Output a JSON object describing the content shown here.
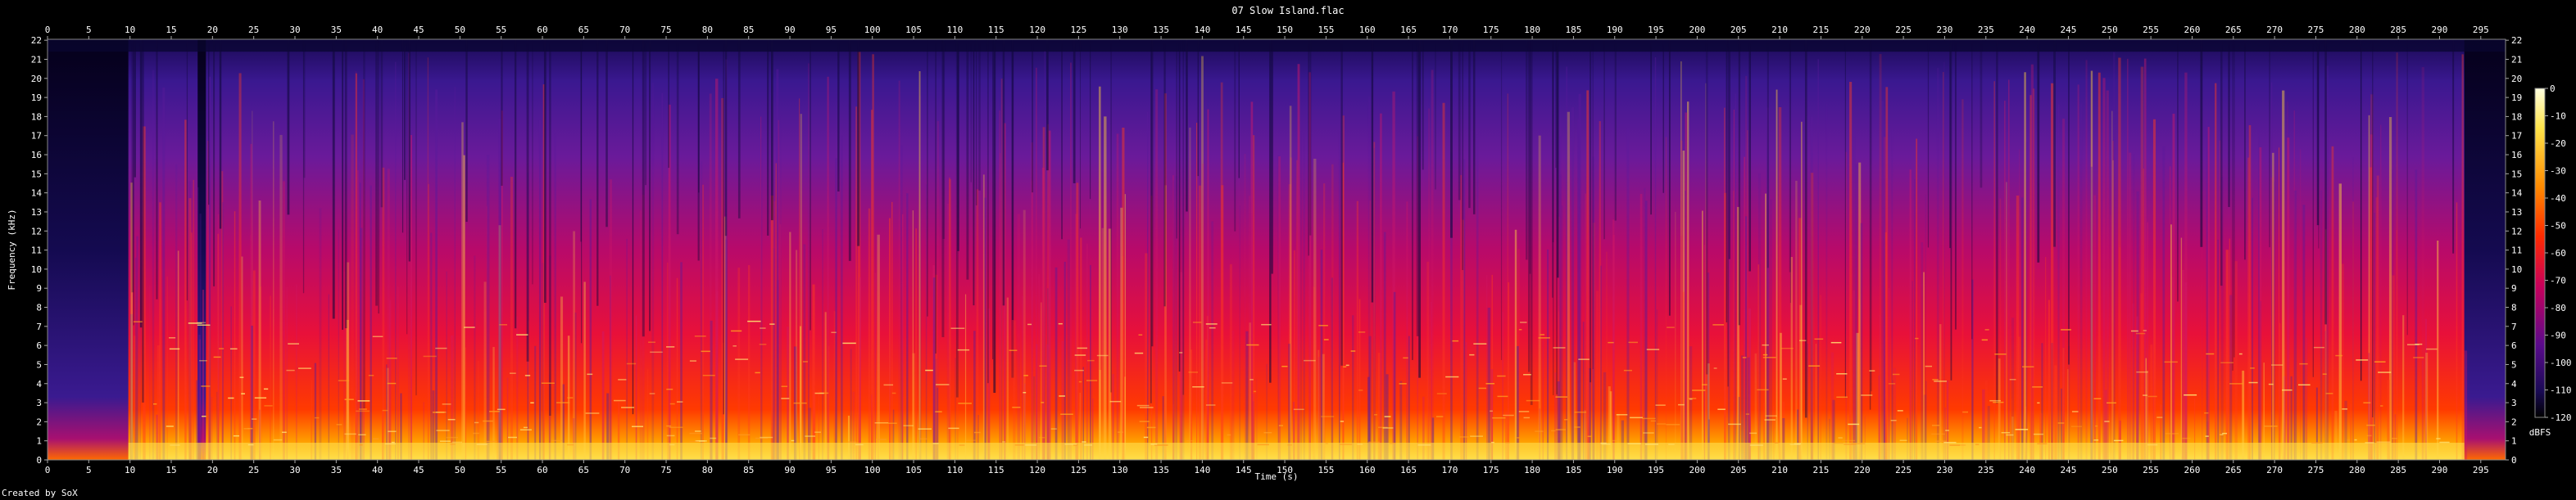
{
  "page": {
    "title": "07 Slow Island.flac",
    "footer": "Created by SoX"
  },
  "chart_data": {
    "type": "heatmap",
    "title": "07 Slow Island.flac",
    "xlabel": "Time (s)",
    "ylabel": "Frequency (kHz)",
    "x_ticks": [
      0,
      5,
      10,
      15,
      20,
      25,
      30,
      35,
      40,
      45,
      50,
      55,
      60,
      65,
      70,
      75,
      80,
      85,
      90,
      95,
      100,
      105,
      110,
      115,
      120,
      125,
      130,
      135,
      140,
      145,
      150,
      155,
      160,
      165,
      170,
      175,
      180,
      185,
      190,
      195,
      200,
      205,
      210,
      215,
      220,
      225,
      230,
      235,
      240,
      245,
      250,
      255,
      260,
      265,
      270,
      275,
      280,
      285,
      290,
      295
    ],
    "y_ticks": [
      0,
      1,
      2,
      3,
      4,
      5,
      6,
      7,
      8,
      9,
      10,
      11,
      12,
      13,
      14,
      15,
      16,
      17,
      18,
      19,
      20,
      21,
      22
    ],
    "xlim": [
      0,
      298
    ],
    "ylim": [
      0,
      22.05
    ],
    "colorbar": {
      "label": "dBFS",
      "ticks": [
        0,
        -10,
        -20,
        -30,
        -40,
        -50,
        -60,
        -70,
        -80,
        -90,
        -100,
        -110,
        -120
      ],
      "range": [
        -120,
        0
      ]
    },
    "colors": {
      "background": "#000000",
      "quiet": "#05001a",
      "low": "#2a0a6e",
      "mid": "#c8005a",
      "high": "#ff2a00",
      "peak": "#ffe44a",
      "max": "#ffffe0"
    }
  }
}
